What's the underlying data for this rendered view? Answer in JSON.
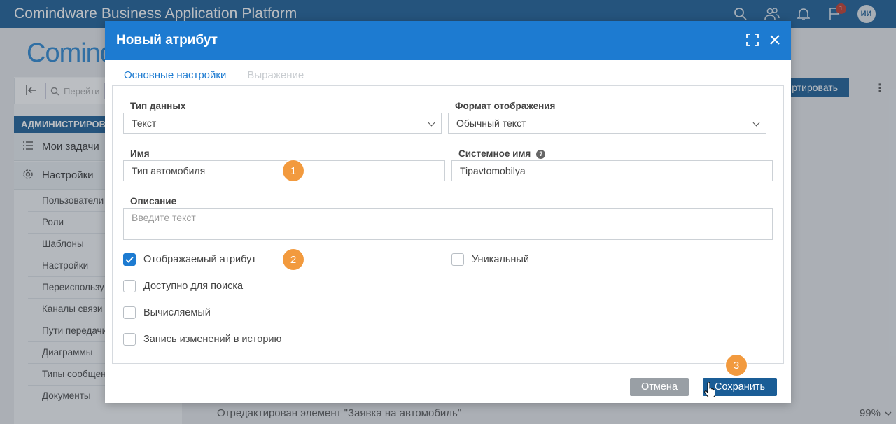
{
  "app": {
    "title": "Comindware Business Application Platform",
    "logo_text": "Comind",
    "notifications_count": "1",
    "user_initials": "ИИ"
  },
  "sidebar": {
    "search_placeholder": "Перейти",
    "section_title": "АДМИНИСТРИРОВА",
    "main_items": [
      {
        "label": "Мои задачи",
        "icon": "tasks-icon"
      },
      {
        "label": "Настройки",
        "icon": "gear-icon"
      }
    ],
    "sub_items": [
      "Пользователи",
      "Роли",
      "Шаблоны",
      "Настройки",
      "Переиспользу",
      "Каналы связи",
      "Пути передачи",
      "Диаграммы",
      "Типы сообщен",
      "Документы"
    ]
  },
  "toolbar": {
    "export_label": "ртировать"
  },
  "status": {
    "message": "Отредактирован элемент \"Заявка на автомобиль\"",
    "zoom": "99%"
  },
  "modal": {
    "title": "Новый атрибут",
    "tabs": [
      {
        "label": "Основные настройки",
        "active": true
      },
      {
        "label": "Выражение",
        "active": false
      }
    ],
    "fields": {
      "data_type": {
        "label": "Тип данных",
        "value": "Текст"
      },
      "display_format": {
        "label": "Формат отображения",
        "value": "Обычный текст"
      },
      "name": {
        "label": "Имя",
        "value": "Тип автомобиля"
      },
      "system_name": {
        "label": "Системное имя",
        "value": "Tipavtomobilya"
      },
      "description": {
        "label": "Описание",
        "placeholder": "Введите текст"
      }
    },
    "checkboxes": {
      "displayed": {
        "label": "Отображаемый атрибут",
        "checked": true
      },
      "unique": {
        "label": "Уникальный",
        "checked": false
      },
      "searchable": {
        "label": "Доступно для поиска",
        "checked": false
      },
      "computed": {
        "label": "Вычисляемый",
        "checked": false
      },
      "history": {
        "label": "Запись изменений в историю",
        "checked": false
      }
    },
    "buttons": {
      "cancel": "Отмена",
      "save": "Сохранить"
    },
    "markers": [
      "1",
      "2",
      "3"
    ]
  },
  "colors": {
    "topbar": "#1a5d96",
    "modal_header": "#1d7bd1",
    "marker": "#f29a3e",
    "save_button": "#1a5d96",
    "cancel_button": "#999fa5"
  }
}
